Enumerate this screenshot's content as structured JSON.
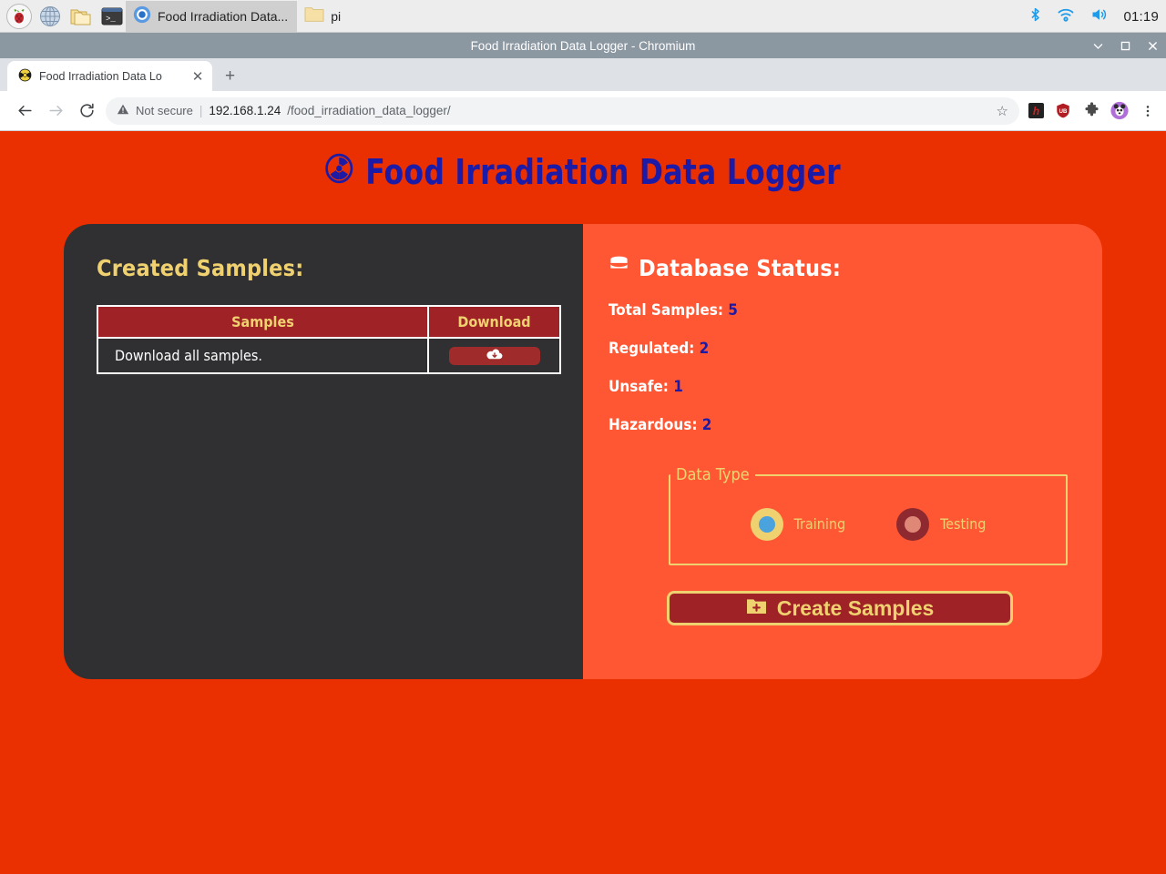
{
  "taskbar": {
    "launchers": [
      {
        "name": "raspberry-menu-icon",
        "label": "Raspberry Pi Menu"
      },
      {
        "name": "web-browser-icon",
        "label": "Web Browser"
      },
      {
        "name": "file-manager-icon",
        "label": "File Manager"
      },
      {
        "name": "terminal-icon",
        "label": "Terminal"
      }
    ],
    "windows": [
      {
        "name": "taskbar-window-chromium",
        "label": "Food Irradiation Data...",
        "icon": "chromium-icon",
        "active": true
      },
      {
        "name": "taskbar-window-filemanager",
        "label": "pi",
        "icon": "folder-icon",
        "active": false
      }
    ],
    "tray": {
      "bluetooth": "bluetooth-icon",
      "wifi": "wifi-icon",
      "volume": "volume-icon",
      "clock": "01:19"
    }
  },
  "window": {
    "title": "Food Irradiation Data Logger - Chromium",
    "controls": {
      "minimize": "⌄",
      "maximize": "□",
      "close": "✕"
    }
  },
  "browser": {
    "tab": {
      "title": "Food Irradiation Data Lo",
      "favicon": "radiation-favicon",
      "close": "✕"
    },
    "new_tab": "+",
    "nav": {
      "back": "←",
      "forward": "→",
      "reload": "↻"
    },
    "omnibox": {
      "security_label": "Not secure",
      "separator": "|",
      "url_host": "192.168.1.24",
      "url_path": "/food_irradiation_data_logger/",
      "bookmark": "☆"
    },
    "extensions": [
      {
        "name": "hola-extension-icon",
        "label": "h"
      },
      {
        "name": "ublock-origin-icon",
        "label": "UB"
      },
      {
        "name": "extensions-puzzle-icon",
        "label": "puzzle"
      },
      {
        "name": "profile-avatar-icon",
        "label": "panda"
      },
      {
        "name": "chrome-menu-icon",
        "label": "⋮"
      }
    ]
  },
  "page": {
    "title": "Food Irradiation Data Logger",
    "title_icon": "radiation-icon",
    "left": {
      "heading": "Created Samples:",
      "table": {
        "columns": [
          "Samples",
          "Download"
        ],
        "rows": [
          {
            "sample": "Download all samples.",
            "download_icon": "cloud-download-icon"
          }
        ]
      }
    },
    "right": {
      "heading": "Database Status:",
      "heading_icon": "database-icon",
      "stats": [
        {
          "label": "Total Samples:",
          "value": "5"
        },
        {
          "label": "Regulated:",
          "value": "2"
        },
        {
          "label": "Unsafe:",
          "value": "1"
        },
        {
          "label": "Hazardous:",
          "value": "2"
        }
      ],
      "data_type": {
        "legend": "Data Type",
        "options": [
          {
            "label": "Training",
            "selected": true
          },
          {
            "label": "Testing",
            "selected": false
          }
        ]
      },
      "create_button": {
        "label": "Create Samples",
        "icon": "folder-plus-icon"
      }
    }
  },
  "colors": {
    "page_bg": "#ea2f00",
    "left_panel": "#303033",
    "right_panel": "#ff5733",
    "accent_yellow": "#f0d170",
    "accent_dark_red": "#9e2226",
    "title_blue": "#1b1ba8"
  }
}
